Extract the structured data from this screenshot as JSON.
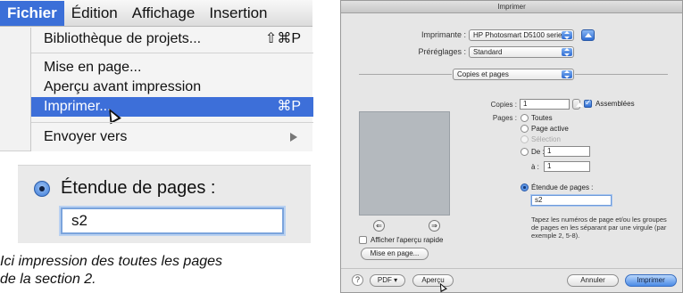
{
  "menu": {
    "bar_items": [
      "Fichier",
      "Édition",
      "Affichage",
      "Insertion"
    ],
    "items": [
      {
        "label": "Bibliothèque de projets...",
        "shortcut": "⇧⌘P"
      },
      {
        "label": "Mise en page..."
      },
      {
        "label": "Aperçu avant impression"
      },
      {
        "label": "Imprimer...",
        "shortcut": "⌘P"
      },
      {
        "label": "Envoyer vers"
      }
    ]
  },
  "extent": {
    "label": "Étendue de pages :",
    "value": "s2"
  },
  "caption": {
    "line1": "Ici impression des toutes les pages",
    "line2": "de la section 2."
  },
  "dialog": {
    "title": "Imprimer",
    "printer_label": "Imprimante :",
    "printer_value": "HP Photosmart D5100 series",
    "presets_label": "Préréglages :",
    "presets_value": "Standard",
    "section_value": "Copies et pages",
    "copies_label": "Copies :",
    "copies_value": "1",
    "collated_label": "Assemblées",
    "pages_label": "Pages :",
    "options": {
      "all": "Toutes",
      "current": "Page active",
      "selection": "Sélection",
      "from": "De :",
      "from_value": "1",
      "to": "à :",
      "to_value": "1",
      "extent": "Étendue de pages :",
      "extent_value": "s2"
    },
    "hint": "Tapez les numéros de page et/ou les groupes de pages en les séparant par une virgule (par exemple 2, 5-8).",
    "quick_preview_label": "Afficher l'aperçu rapide",
    "page_setup_button": "Mise en page...",
    "help": "?",
    "pdf_button": "PDF ▾",
    "preview_button": "Aperçu",
    "cancel_button": "Annuler",
    "print_button": "Imprimer",
    "nav_prev": "⇐",
    "nav_next": "⇒"
  },
  "colors": {
    "menu_highlight": "#3d6fd9",
    "accent_blue": "#2e6bd2"
  }
}
